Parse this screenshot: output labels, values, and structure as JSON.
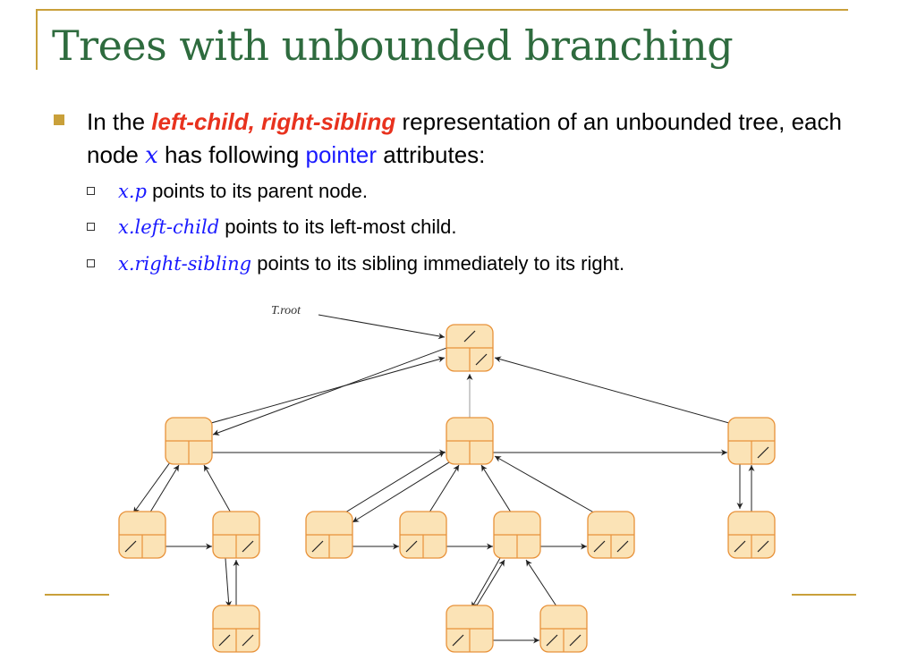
{
  "slide": {
    "title": "Trees with unbounded branching",
    "bullet": {
      "prefix": "In the ",
      "emphasis": "left-child, right-sibling",
      "middle": " representation of an unbounded tree, each node ",
      "var": "x",
      "middle2": " has following ",
      "link": "pointer",
      "suffix": " attributes:"
    },
    "sub_bullets": [
      {
        "code": "x.p",
        "text": " points to its parent node."
      },
      {
        "code": "x.left-child",
        "text": " points to its left-most child."
      },
      {
        "code": "x.right-sibling",
        "text": " points to its sibling immediately to its right."
      }
    ]
  },
  "diagram": {
    "root_label": "T.root",
    "colors": {
      "node_fill": "#fbe3b6",
      "node_border": "#e8923a",
      "arrow": "#222222",
      "accent_gold": "#c9a03a",
      "title_green": "#2e6b3e",
      "emphasis_red": "#e8321e",
      "link_blue": "#1a1aff"
    }
  }
}
